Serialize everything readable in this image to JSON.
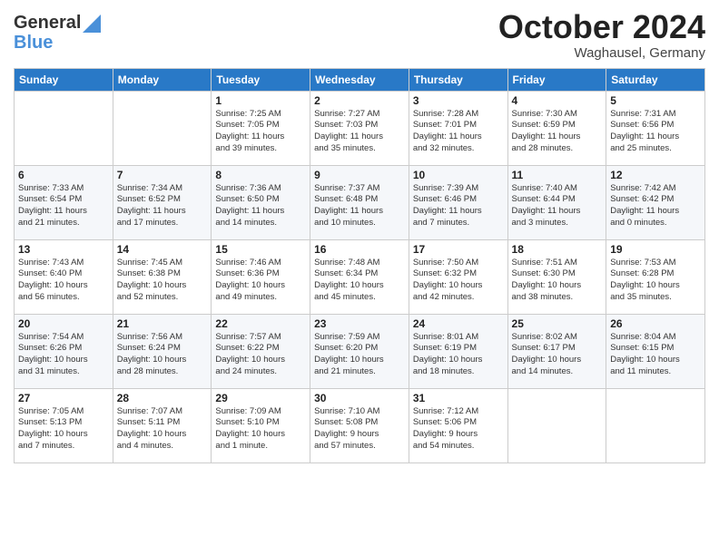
{
  "header": {
    "logo_line1": "General",
    "logo_line2": "Blue",
    "month": "October 2024",
    "location": "Waghausel, Germany"
  },
  "days_of_week": [
    "Sunday",
    "Monday",
    "Tuesday",
    "Wednesday",
    "Thursday",
    "Friday",
    "Saturday"
  ],
  "weeks": [
    [
      {
        "day": "",
        "content": ""
      },
      {
        "day": "",
        "content": ""
      },
      {
        "day": "1",
        "content": "Sunrise: 7:25 AM\nSunset: 7:05 PM\nDaylight: 11 hours\nand 39 minutes."
      },
      {
        "day": "2",
        "content": "Sunrise: 7:27 AM\nSunset: 7:03 PM\nDaylight: 11 hours\nand 35 minutes."
      },
      {
        "day": "3",
        "content": "Sunrise: 7:28 AM\nSunset: 7:01 PM\nDaylight: 11 hours\nand 32 minutes."
      },
      {
        "day": "4",
        "content": "Sunrise: 7:30 AM\nSunset: 6:59 PM\nDaylight: 11 hours\nand 28 minutes."
      },
      {
        "day": "5",
        "content": "Sunrise: 7:31 AM\nSunset: 6:56 PM\nDaylight: 11 hours\nand 25 minutes."
      }
    ],
    [
      {
        "day": "6",
        "content": "Sunrise: 7:33 AM\nSunset: 6:54 PM\nDaylight: 11 hours\nand 21 minutes."
      },
      {
        "day": "7",
        "content": "Sunrise: 7:34 AM\nSunset: 6:52 PM\nDaylight: 11 hours\nand 17 minutes."
      },
      {
        "day": "8",
        "content": "Sunrise: 7:36 AM\nSunset: 6:50 PM\nDaylight: 11 hours\nand 14 minutes."
      },
      {
        "day": "9",
        "content": "Sunrise: 7:37 AM\nSunset: 6:48 PM\nDaylight: 11 hours\nand 10 minutes."
      },
      {
        "day": "10",
        "content": "Sunrise: 7:39 AM\nSunset: 6:46 PM\nDaylight: 11 hours\nand 7 minutes."
      },
      {
        "day": "11",
        "content": "Sunrise: 7:40 AM\nSunset: 6:44 PM\nDaylight: 11 hours\nand 3 minutes."
      },
      {
        "day": "12",
        "content": "Sunrise: 7:42 AM\nSunset: 6:42 PM\nDaylight: 11 hours\nand 0 minutes."
      }
    ],
    [
      {
        "day": "13",
        "content": "Sunrise: 7:43 AM\nSunset: 6:40 PM\nDaylight: 10 hours\nand 56 minutes."
      },
      {
        "day": "14",
        "content": "Sunrise: 7:45 AM\nSunset: 6:38 PM\nDaylight: 10 hours\nand 52 minutes."
      },
      {
        "day": "15",
        "content": "Sunrise: 7:46 AM\nSunset: 6:36 PM\nDaylight: 10 hours\nand 49 minutes."
      },
      {
        "day": "16",
        "content": "Sunrise: 7:48 AM\nSunset: 6:34 PM\nDaylight: 10 hours\nand 45 minutes."
      },
      {
        "day": "17",
        "content": "Sunrise: 7:50 AM\nSunset: 6:32 PM\nDaylight: 10 hours\nand 42 minutes."
      },
      {
        "day": "18",
        "content": "Sunrise: 7:51 AM\nSunset: 6:30 PM\nDaylight: 10 hours\nand 38 minutes."
      },
      {
        "day": "19",
        "content": "Sunrise: 7:53 AM\nSunset: 6:28 PM\nDaylight: 10 hours\nand 35 minutes."
      }
    ],
    [
      {
        "day": "20",
        "content": "Sunrise: 7:54 AM\nSunset: 6:26 PM\nDaylight: 10 hours\nand 31 minutes."
      },
      {
        "day": "21",
        "content": "Sunrise: 7:56 AM\nSunset: 6:24 PM\nDaylight: 10 hours\nand 28 minutes."
      },
      {
        "day": "22",
        "content": "Sunrise: 7:57 AM\nSunset: 6:22 PM\nDaylight: 10 hours\nand 24 minutes."
      },
      {
        "day": "23",
        "content": "Sunrise: 7:59 AM\nSunset: 6:20 PM\nDaylight: 10 hours\nand 21 minutes."
      },
      {
        "day": "24",
        "content": "Sunrise: 8:01 AM\nSunset: 6:19 PM\nDaylight: 10 hours\nand 18 minutes."
      },
      {
        "day": "25",
        "content": "Sunrise: 8:02 AM\nSunset: 6:17 PM\nDaylight: 10 hours\nand 14 minutes."
      },
      {
        "day": "26",
        "content": "Sunrise: 8:04 AM\nSunset: 6:15 PM\nDaylight: 10 hours\nand 11 minutes."
      }
    ],
    [
      {
        "day": "27",
        "content": "Sunrise: 7:05 AM\nSunset: 5:13 PM\nDaylight: 10 hours\nand 7 minutes."
      },
      {
        "day": "28",
        "content": "Sunrise: 7:07 AM\nSunset: 5:11 PM\nDaylight: 10 hours\nand 4 minutes."
      },
      {
        "day": "29",
        "content": "Sunrise: 7:09 AM\nSunset: 5:10 PM\nDaylight: 10 hours\nand 1 minute."
      },
      {
        "day": "30",
        "content": "Sunrise: 7:10 AM\nSunset: 5:08 PM\nDaylight: 9 hours\nand 57 minutes."
      },
      {
        "day": "31",
        "content": "Sunrise: 7:12 AM\nSunset: 5:06 PM\nDaylight: 9 hours\nand 54 minutes."
      },
      {
        "day": "",
        "content": ""
      },
      {
        "day": "",
        "content": ""
      }
    ]
  ]
}
